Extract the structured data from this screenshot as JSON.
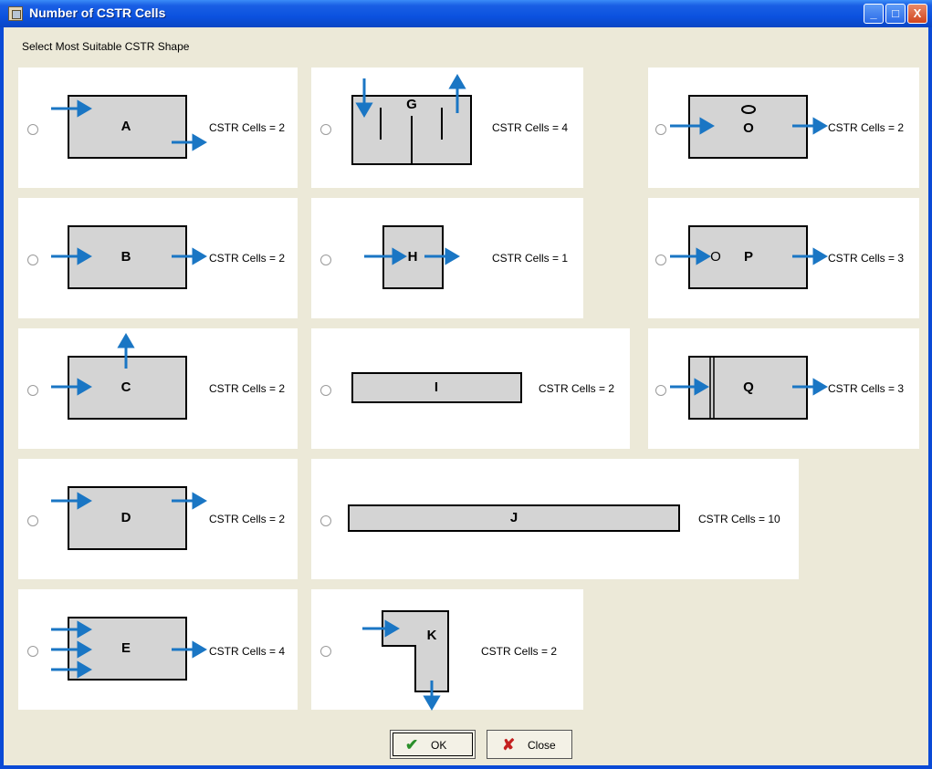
{
  "window": {
    "title": "Number of CSTR Cells",
    "controls": {
      "minimize": "_",
      "maximize": "□",
      "close": "X"
    }
  },
  "group_label": "Select Most Suitable CSTR Shape",
  "shapes": [
    {
      "letter": "A",
      "cells": "CSTR Cells = 2"
    },
    {
      "letter": "B",
      "cells": "CSTR Cells = 2"
    },
    {
      "letter": "C",
      "cells": "CSTR Cells = 2"
    },
    {
      "letter": "D",
      "cells": "CSTR Cells = 2"
    },
    {
      "letter": "E",
      "cells": "CSTR Cells = 4"
    },
    {
      "letter": "G",
      "cells": "CSTR Cells = 4"
    },
    {
      "letter": "H",
      "cells": "CSTR Cells = 1"
    },
    {
      "letter": "I",
      "cells": "CSTR Cells = 2"
    },
    {
      "letter": "J",
      "cells": "CSTR Cells = 10"
    },
    {
      "letter": "K",
      "cells": "CSTR Cells = 2"
    },
    {
      "letter": "O",
      "cells": "CSTR Cells = 2"
    },
    {
      "letter": "P",
      "cells": "CSTR Cells = 3"
    },
    {
      "letter": "Q",
      "cells": "CSTR Cells = 3"
    }
  ],
  "p_marker": "O",
  "buttons": {
    "ok": "OK",
    "close": "Close"
  },
  "icons": {
    "ok": "check-icon",
    "close": "x-icon"
  },
  "colors": {
    "arrow": "#1a76c4",
    "shape_fill": "#d4d4d4",
    "window_bg": "#ece9d8",
    "titlebar": "#0b52df"
  }
}
